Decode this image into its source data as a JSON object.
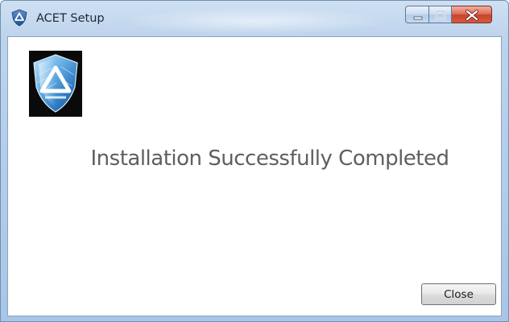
{
  "window": {
    "title": "ACET Setup",
    "app_icon": "acet-shield-icon",
    "caption_buttons": {
      "minimize_icon": "minimize-icon",
      "maximize_icon": "maximize-icon",
      "close_icon": "close-icon"
    }
  },
  "content": {
    "logo": "acet-shield-logo",
    "message": "Installation Successfully Completed"
  },
  "buttons": {
    "close_label": "Close"
  },
  "colors": {
    "frame": "#bcd3ec",
    "caption_close": "#c8442e",
    "message_text": "#5f5f5f",
    "logo_blue": "#6fb6e8"
  }
}
